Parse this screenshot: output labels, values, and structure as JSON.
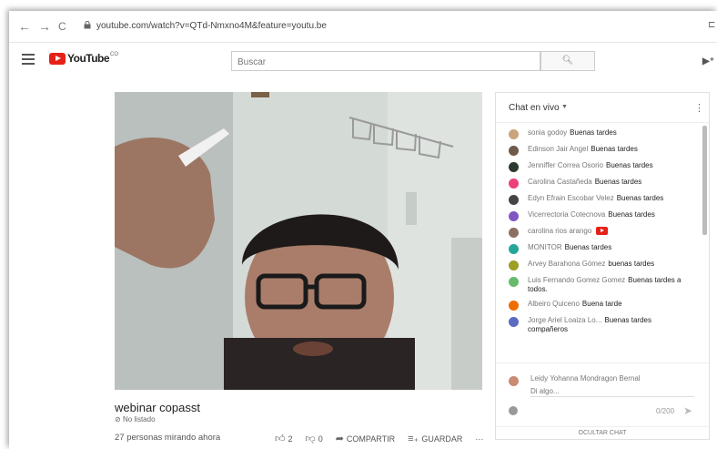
{
  "browser": {
    "url": "youtube.com/watch?v=QTd-Nmxno4M&feature=youtu.be",
    "back": "←",
    "forward": "→",
    "reload": "C",
    "cast": "⊏"
  },
  "youtube": {
    "logo_text": "YouTube",
    "region": "CO",
    "search_placeholder": "Buscar",
    "search_icon": "🔍︎",
    "video_icon": "▶⁺"
  },
  "video": {
    "title": "webinar copasst",
    "unlisted_label": "No listado",
    "views": "27 personas mirando ahora",
    "likes": "2",
    "dislikes": "0",
    "share_label": "COMPARTIR",
    "save_label": "GUARDAR",
    "more_label": "···"
  },
  "chat": {
    "header": "Chat en vivo",
    "messages": [
      {
        "name": "sonia godoy",
        "text": "Buenas tardes",
        "color": "#c9a47c"
      },
      {
        "name": "Edinson Jair Angel",
        "text": "Buenas tardes",
        "color": "#6d5a4a"
      },
      {
        "name": "Jenniffer Correa Osorio",
        "text": "Buenas tardes",
        "color": "#2b3a2e"
      },
      {
        "name": "Carolina Castañeda",
        "text": "Buenas tardes",
        "color": "#ec407a"
      },
      {
        "name": "Edyn Efrain Escobar Velez",
        "text": "Buenas tardes",
        "color": "#444444"
      },
      {
        "name": "Vicerrectoria Cotecnova",
        "text": "Buenas tardes",
        "color": "#7e57c2"
      },
      {
        "name": "carolina rios arango",
        "text": "",
        "color": "#8d6e63"
      },
      {
        "name": "MONITOR",
        "text": "Buenas tardes",
        "color": "#26a69a"
      },
      {
        "name": "Arvey Barahona Gómez",
        "text": "buenas tardes",
        "color": "#9e9d24"
      },
      {
        "name": "Luis Fernando Gomez Gomez",
        "text": "Buenas tardes a todos.",
        "color": "#66bb6a"
      },
      {
        "name": "Albeiro Quiceno",
        "text": "Buena tarde",
        "color": "#ef6c00"
      },
      {
        "name": "Jorge Ariel Loaiza Lo...",
        "text": "Buenas tardes compañeros",
        "color": "#5c6bc0"
      }
    ],
    "composer_name": "Leidy Yohanna Mondragon Bernal",
    "composer_placeholder": "Di algo...",
    "char_count": "0/200",
    "hide_label": "OCULTAR CHAT"
  }
}
